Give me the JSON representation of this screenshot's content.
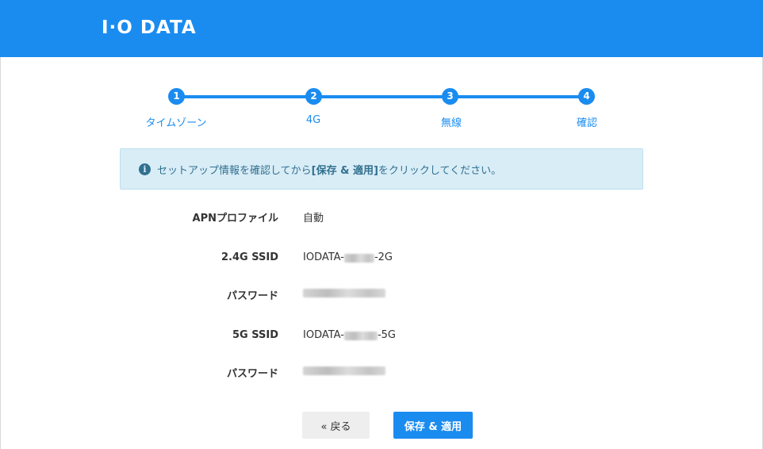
{
  "header": {
    "logo": "I·O DATA",
    "color": "#1a8cf0"
  },
  "stepper": {
    "steps": [
      {
        "number": "1",
        "label": "タイムゾーン"
      },
      {
        "number": "2",
        "label": "4G"
      },
      {
        "number": "3",
        "label": "無線"
      },
      {
        "number": "4",
        "label": "確認"
      }
    ]
  },
  "alert": {
    "icon": "info-circle-icon",
    "text_before": "セットアップ情報を確認してから",
    "text_bold": "[保存 & 適用]",
    "text_after": "をクリックしてください。"
  },
  "summary": {
    "apn_label": "APNプロファイル",
    "apn_value": "自動",
    "ssid24_label": "2.4G SSID",
    "ssid24_prefix": "IODATA-",
    "ssid24_suffix": "-2G",
    "password1_label": "パスワード",
    "ssid5_label": "5G SSID",
    "ssid5_prefix": "IODATA-",
    "ssid5_suffix": "-5G",
    "password2_label": "パスワード"
  },
  "buttons": {
    "back_label": "« 戻る",
    "save_label": "保存 & 適用"
  }
}
